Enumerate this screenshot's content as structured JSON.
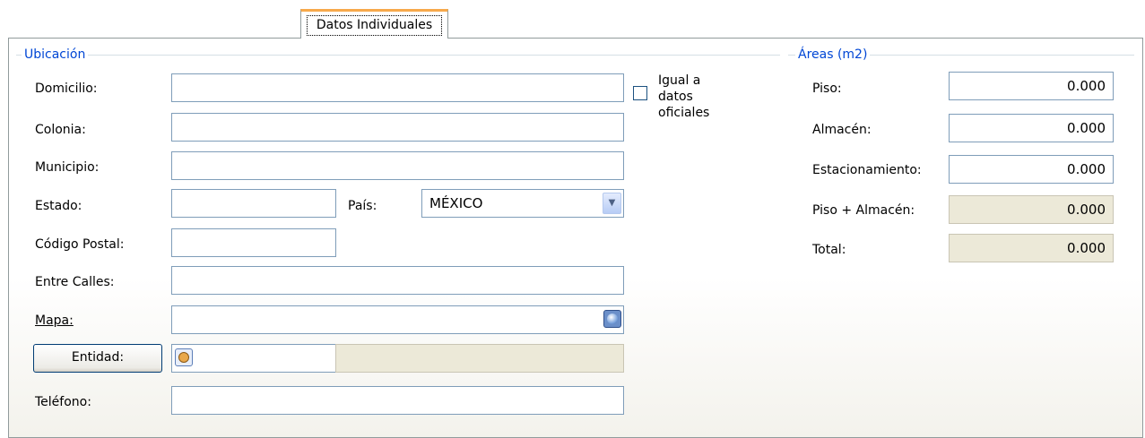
{
  "tab": {
    "label": "Datos Individuales"
  },
  "ubicacion": {
    "title": "Ubicación",
    "domicilio": {
      "label": "Domicilio:",
      "value": ""
    },
    "colonia": {
      "label": "Colonia:",
      "value": ""
    },
    "municipio": {
      "label": "Municipio:",
      "value": ""
    },
    "estado": {
      "label": "Estado:",
      "value": ""
    },
    "pais": {
      "label": "País:",
      "value": "MÉXICO"
    },
    "codigo_postal": {
      "label": "Código Postal:",
      "value": ""
    },
    "entre_calles": {
      "label": "Entre Calles:",
      "value": ""
    },
    "mapa": {
      "label": "Mapa:",
      "value": ""
    },
    "entidad": {
      "button_label": "Entidad:",
      "code": "",
      "name": ""
    },
    "telefono": {
      "label": "Teléfono:",
      "value": ""
    },
    "igual_checkbox": {
      "label_lines": [
        "Igual a",
        "datos",
        "oficiales"
      ],
      "checked": false
    }
  },
  "areas": {
    "title": "Áreas (m2)",
    "piso": {
      "label": "Piso:",
      "value": "0.000"
    },
    "almacen": {
      "label": "Almacén:",
      "value": "0.000"
    },
    "estacionamiento": {
      "label": "Estacionamiento:",
      "value": "0.000"
    },
    "piso_almacen": {
      "label": "Piso + Almacén:",
      "value": "0.000"
    },
    "total": {
      "label": "Total:",
      "value": "0.000"
    }
  },
  "icons": {
    "map": "globe-icon",
    "entity_search": "search-icon",
    "dropdown": "chevron-down-icon"
  },
  "colors": {
    "group_title": "#0046d5",
    "tab_accent": "#f7a94b",
    "readonly_bg": "#ece9d8",
    "input_border": "#7f9db9"
  }
}
